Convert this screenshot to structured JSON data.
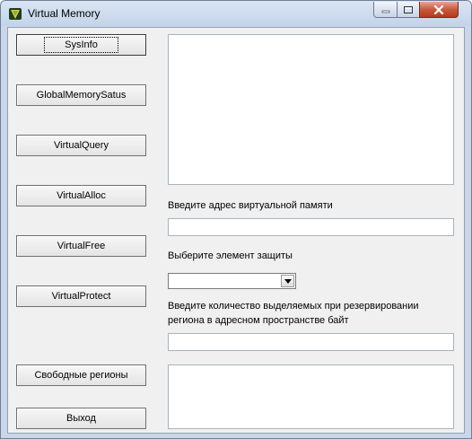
{
  "window": {
    "title": "Virtual Memory"
  },
  "buttons": {
    "sysinfo": "SysInfo",
    "global_memory_status": "GlobalMemorySatus",
    "virtual_query": "VirtualQuery",
    "virtual_alloc": "VirtualAlloc",
    "virtual_free": "VirtualFree",
    "virtual_protect": "VirtualProtect",
    "free_regions": "Свободные регионы",
    "exit": "Выход"
  },
  "labels": {
    "address": "Введите адрес виртуальной памяти",
    "protection": "Выберите элемент защиты",
    "bytes_line1": "Введите количество выделяемых при резервировании",
    "bytes_line2": "региона в адресном пространстве байт"
  },
  "fields": {
    "address_value": "",
    "protection_value": "",
    "bytes_value": "",
    "output_text": "",
    "regions_text": ""
  },
  "icons": {
    "app": "app-logo-icon",
    "minimize": "minimize-icon",
    "maximize": "maximize-icon",
    "close": "close-icon",
    "dropdown": "chevron-down-icon"
  },
  "colors": {
    "title_bar": "#c9d7e8",
    "client_bg": "#f0f0f0",
    "close_button": "#c85a3e"
  }
}
